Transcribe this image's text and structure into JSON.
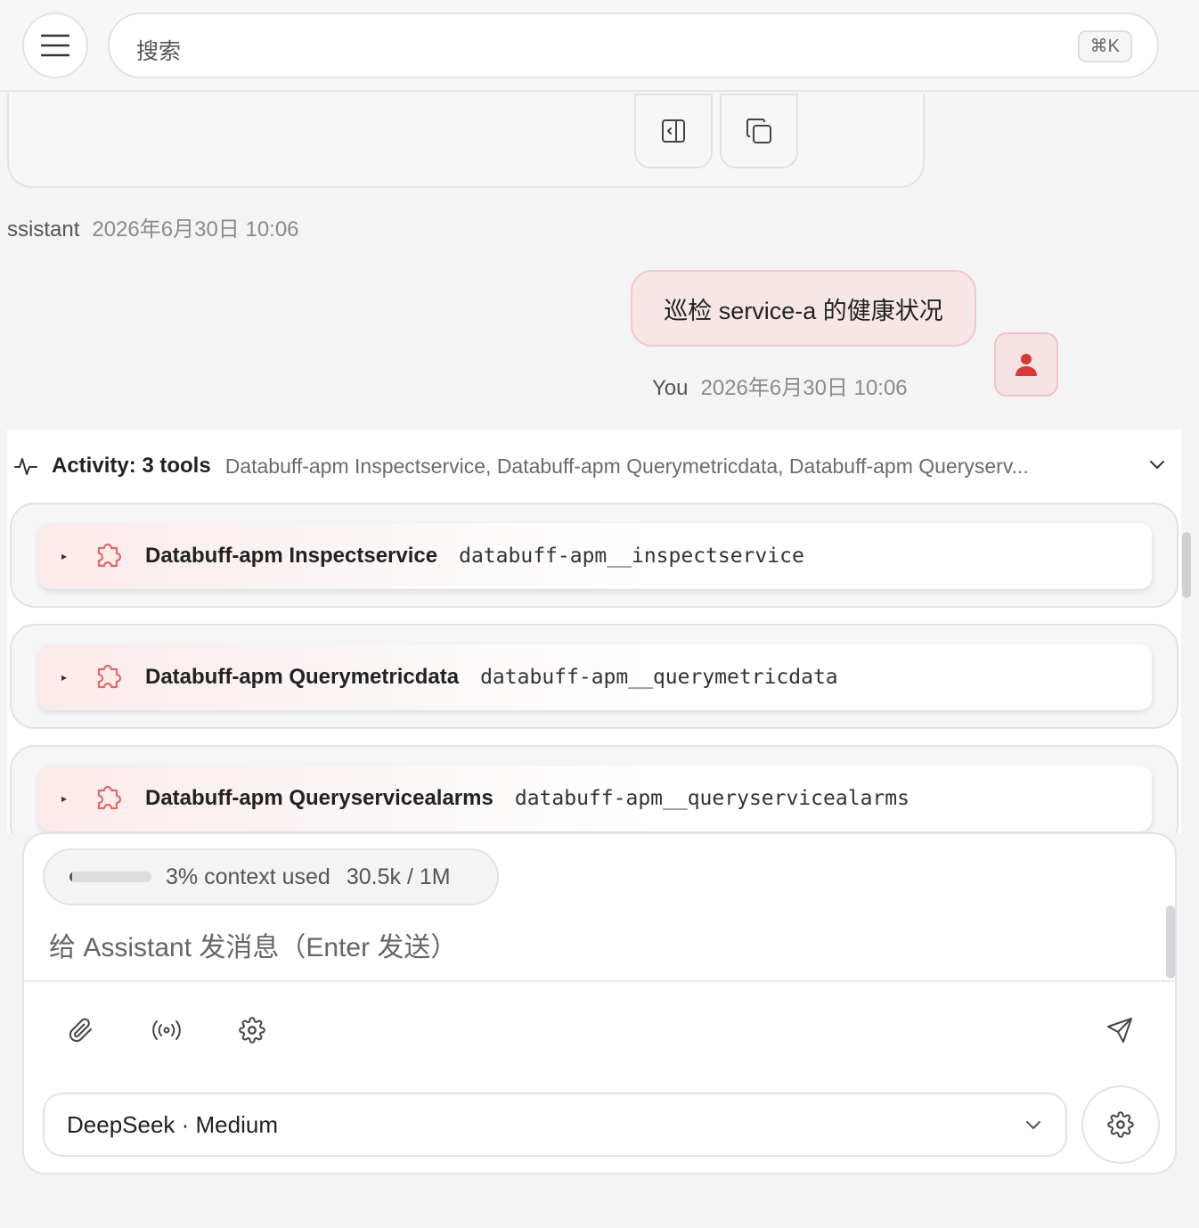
{
  "header": {
    "search_placeholder": "搜索",
    "shortcut": "⌘K",
    "menu_icon": "hamburger-icon"
  },
  "previous_message": {
    "actions": [
      "panel-collapse-icon",
      "copy-icon"
    ]
  },
  "assistant_meta": {
    "name": "ssistant",
    "timestamp": "2026年6月30日 10:06"
  },
  "user_message": {
    "text": "巡检 service-a 的健康状况",
    "name": "You",
    "timestamp": "2026年6月30日 10:06",
    "avatar_icon": "user-icon",
    "accent": "#d93838"
  },
  "activity": {
    "title": "Activity: 3 tools",
    "tools_summary": "Databuff-apm Inspectservice, Databuff-apm Querymetricdata, Databuff-apm Queryserv...",
    "tools": [
      {
        "name": "Databuff-apm Inspectservice",
        "id": "databuff-apm__inspectservice"
      },
      {
        "name": "Databuff-apm Querymetricdata",
        "id": "databuff-apm__querymetricdata"
      },
      {
        "name": "Databuff-apm Queryservicealarms",
        "id": "databuff-apm__queryservicealarms"
      }
    ]
  },
  "composer": {
    "context_label": "3% context used",
    "context_tokens": "30.5k / 1M",
    "context_fraction": 0.03,
    "placeholder": "给 Assistant 发消息（Enter 发送）",
    "model": "DeepSeek · Medium"
  }
}
